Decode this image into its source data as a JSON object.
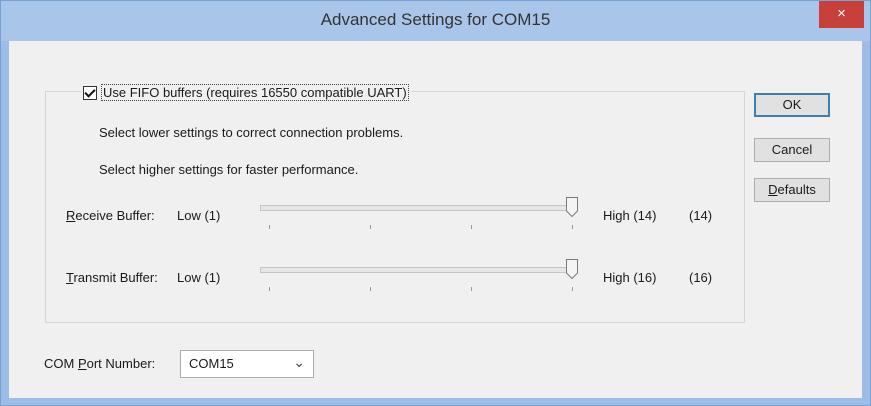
{
  "window": {
    "title": "Advanced Settings for COM15",
    "close_glyph": "×"
  },
  "fifo": {
    "label": "Use FIFO buffers (requires 16550 compatible UART)",
    "checked": true
  },
  "hints": {
    "lower": "Select lower settings to correct connection problems.",
    "higher": "Select higher settings for faster performance."
  },
  "receive": {
    "label_hotkey": "R",
    "label_rest": "eceive Buffer:",
    "low": "Low (1)",
    "high": "High (14)",
    "value": "(14)",
    "level": 14,
    "min": 1,
    "max": 14
  },
  "transmit": {
    "label_hotkey": "T",
    "label_rest": "ransmit Buffer:",
    "low": "Low (1)",
    "high": "High (16)",
    "value": "(16)",
    "level": 16,
    "min": 1,
    "max": 16
  },
  "buttons": {
    "ok": "OK",
    "cancel": "Cancel",
    "defaults_hotkey": "D",
    "defaults_rest": "efaults"
  },
  "com_port": {
    "label_pre": "COM ",
    "label_hotkey": "P",
    "label_rest": "ort Number:",
    "selected": "COM15"
  },
  "colors": {
    "title_bar": "#a9c6ea",
    "close_button": "#c7413a",
    "default_button_border": "#3c7fb1"
  }
}
